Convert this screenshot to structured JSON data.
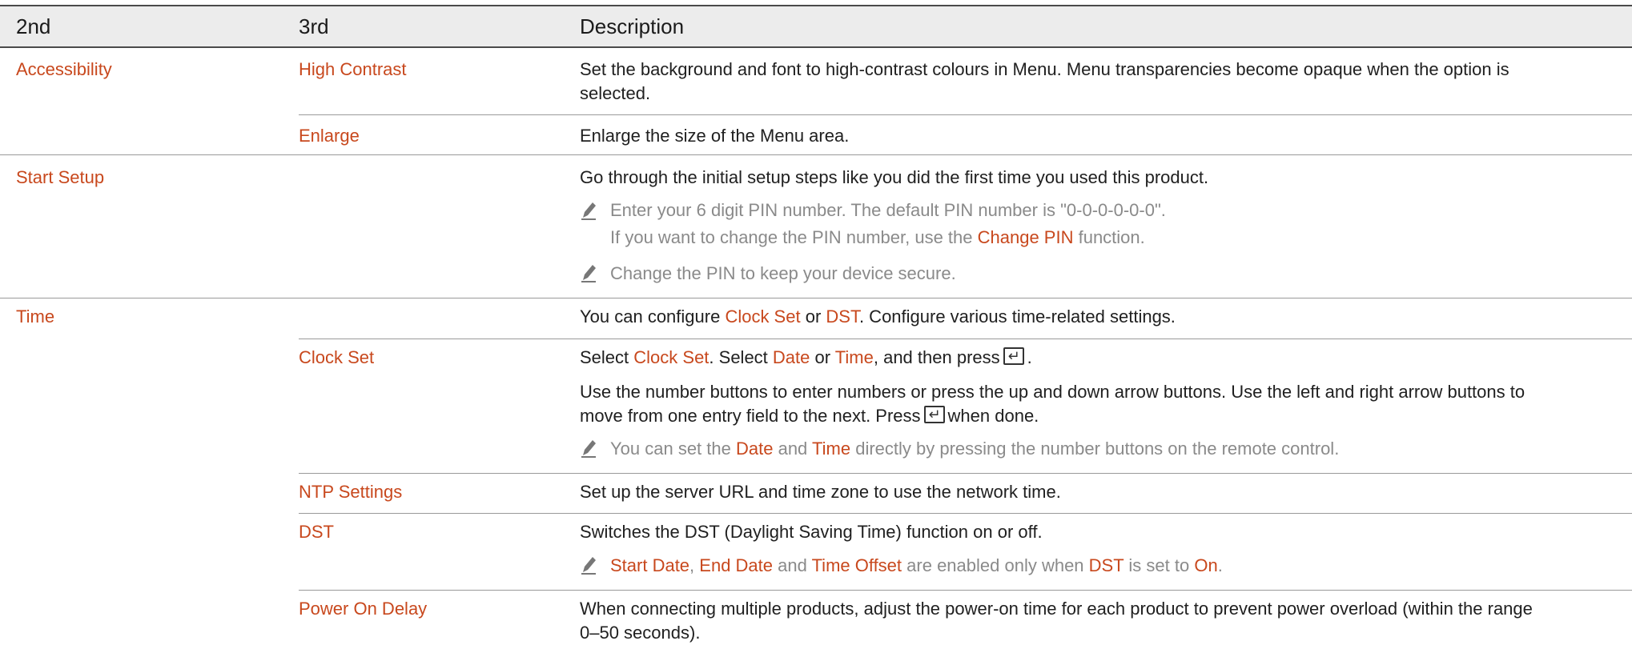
{
  "table": {
    "headers": {
      "col1": "2nd",
      "col2": "3rd",
      "col3": "Description"
    },
    "rows": {
      "accessibility": {
        "label": "Accessibility"
      },
      "high_contrast": {
        "label": "High Contrast",
        "desc_line1": "Set the background and font to high-contrast colours in Menu. Menu transparencies become opaque when the option is",
        "desc_line2": "selected."
      },
      "enlarge": {
        "label": "Enlarge",
        "desc": "Enlarge the size of the Menu area."
      },
      "start_setup": {
        "label": "Start Setup",
        "desc": "Go through the initial setup steps like you did the first time you used this product.",
        "note1_line1": "Enter your 6 digit PIN number. The default PIN number is \"0-0-0-0-0-0\".",
        "note1_line2_a": "If you want to change the PIN number, use the ",
        "note1_line2_link": "Change PIN",
        "note1_line2_b": " function.",
        "note2": "Change the PIN to keep your device secure."
      },
      "time": {
        "label": "Time",
        "desc_a": "You can configure ",
        "desc_link1": "Clock Set",
        "desc_b": " or ",
        "desc_link2": "DST",
        "desc_c": ". Configure various time-related settings."
      },
      "clock_set": {
        "label": "Clock Set",
        "d1_a": "Select ",
        "d1_link1": "Clock Set",
        "d1_b": ". Select ",
        "d1_link2": "Date",
        "d1_c": " or ",
        "d1_link3": "Time",
        "d1_d": ", and then press",
        "d1_e": ".",
        "d2_line1": "Use the number buttons to enter numbers or press the up and down arrow buttons. Use the left and right arrow buttons to",
        "d2_line2_a": "move from one entry field to the next. Press",
        "d2_line2_b": "when done.",
        "note_a": "You can set the ",
        "note_link1": "Date",
        "note_b": " and ",
        "note_link2": "Time",
        "note_c": " directly by pressing the number buttons on the remote control."
      },
      "ntp": {
        "label": "NTP Settings",
        "desc": "Set up the server URL and time zone to use the network time."
      },
      "dst": {
        "label": "DST",
        "desc": "Switches the DST (Daylight Saving Time) function on or off.",
        "note_link1": "Start Date",
        "note_a": ", ",
        "note_link2": "End Date",
        "note_b": " and ",
        "note_link3": "Time Offset",
        "note_c": " are enabled only when ",
        "note_link4": "DST",
        "note_d": " is set to ",
        "note_link5": "On",
        "note_e": "."
      },
      "power_on_delay": {
        "label": "Power On Delay",
        "desc_line1": "When connecting multiple products, adjust the power-on time for each product to prevent power overload (within the range",
        "desc_line2": "0–50 seconds)."
      }
    },
    "colors": {
      "accent": "#c8481d",
      "note_text": "#8a8a8a",
      "header_bg": "#ececec"
    },
    "icons": {
      "note": "pencil-note-icon",
      "enter": "enter-key-icon"
    }
  }
}
